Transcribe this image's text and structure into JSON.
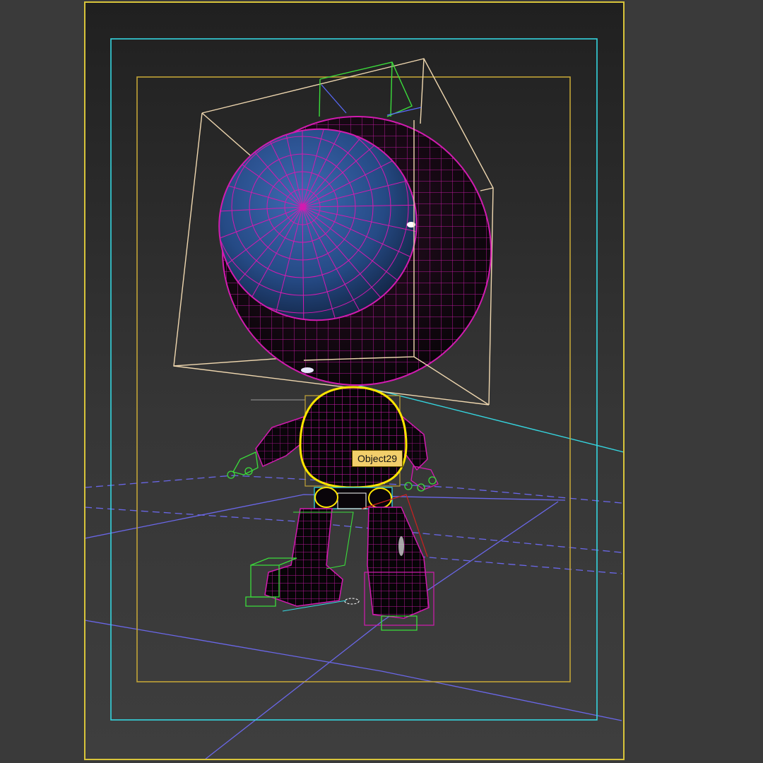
{
  "viewport": {
    "hover_tooltip": "Object29",
    "colors": {
      "background": "#3b3b3b",
      "render_frame": "#d8c43a",
      "safe_frame_action": "#35d6e0",
      "safe_frame_title": "#c2a437",
      "wireframe_mesh": "#d21bb0",
      "selection_outline": "#ffe600",
      "bounding_box": "#f0d8b0",
      "helper_gizmo": "#3bdc3b",
      "grid_line": "#6a67e8",
      "visor_fill": "#2b4f86"
    },
    "objects": [
      "character-head",
      "character-visor",
      "character-torso",
      "character-left-arm",
      "character-right-arm",
      "character-left-leg",
      "character-right-leg"
    ]
  }
}
